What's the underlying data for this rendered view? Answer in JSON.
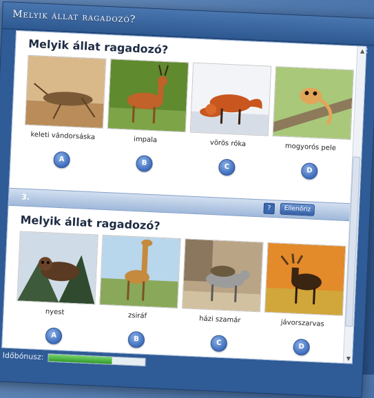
{
  "window": {
    "title": "Melyik állat ragadozó?"
  },
  "questions": [
    {
      "prompt": "Melyik állat ragadozó?",
      "options": [
        {
          "letter": "A",
          "label": "keleti vándorsáska",
          "photo": "grasshopper-photo"
        },
        {
          "letter": "B",
          "label": "impala",
          "photo": "impala-photo"
        },
        {
          "letter": "C",
          "label": "vörös róka",
          "photo": "fox-photo"
        },
        {
          "letter": "D",
          "label": "mogyorós pele",
          "photo": "dormouse-photo"
        }
      ]
    },
    {
      "number": "3.",
      "help_label": "?",
      "check_label": "Ellenőriz",
      "prompt": "Melyik állat ragadozó?",
      "options": [
        {
          "letter": "A",
          "label": "nyest",
          "photo": "marten-photo"
        },
        {
          "letter": "B",
          "label": "zsiráf",
          "photo": "giraffe-photo"
        },
        {
          "letter": "C",
          "label": "házi szamár",
          "photo": "donkey-photo"
        },
        {
          "letter": "D",
          "label": "jávorszarvas",
          "photo": "moose-photo"
        }
      ]
    }
  ],
  "footer": {
    "bonus_label": "Időbónusz:",
    "bonus_progress": 0.66
  },
  "colors": {
    "accent": "#3d6cbc",
    "window": "#2f5b96",
    "progress": "#3fa536"
  }
}
